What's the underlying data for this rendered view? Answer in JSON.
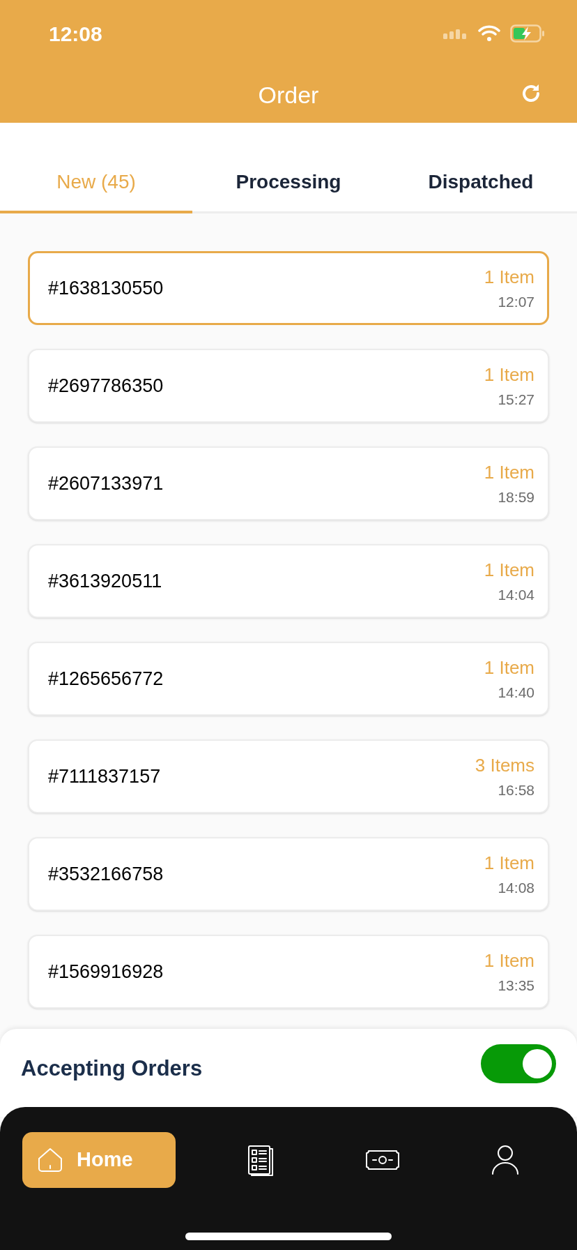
{
  "status_bar": {
    "time": "12:08"
  },
  "header": {
    "title": "Order"
  },
  "tabs": [
    {
      "label": "New (45)",
      "selected": true
    },
    {
      "label": "Processing",
      "selected": false
    },
    {
      "label": "Dispatched",
      "selected": false
    }
  ],
  "orders": [
    {
      "number": "#1638130550",
      "items": "1 Item",
      "time": "12:07",
      "selected": true
    },
    {
      "number": "#2697786350",
      "items": "1 Item",
      "time": "15:27",
      "selected": false
    },
    {
      "number": "#2607133971",
      "items": "1 Item",
      "time": "18:59",
      "selected": false
    },
    {
      "number": "#3613920511",
      "items": "1 Item",
      "time": "14:04",
      "selected": false
    },
    {
      "number": "#1265656772",
      "items": "1 Item",
      "time": "14:40",
      "selected": false
    },
    {
      "number": "#7111837157",
      "items": "3 Items",
      "time": "16:58",
      "selected": false
    },
    {
      "number": "#3532166758",
      "items": "1 Item",
      "time": "14:08",
      "selected": false
    },
    {
      "number": "#1569916928",
      "items": "1 Item",
      "time": "13:35",
      "selected": false
    }
  ],
  "accepting": {
    "label": "Accepting Orders",
    "on": true
  },
  "nav": [
    {
      "kind": "home",
      "label": "Home",
      "selected": true
    },
    {
      "kind": "list",
      "selected": false
    },
    {
      "kind": "money",
      "selected": false
    },
    {
      "kind": "profile",
      "selected": false
    }
  ]
}
